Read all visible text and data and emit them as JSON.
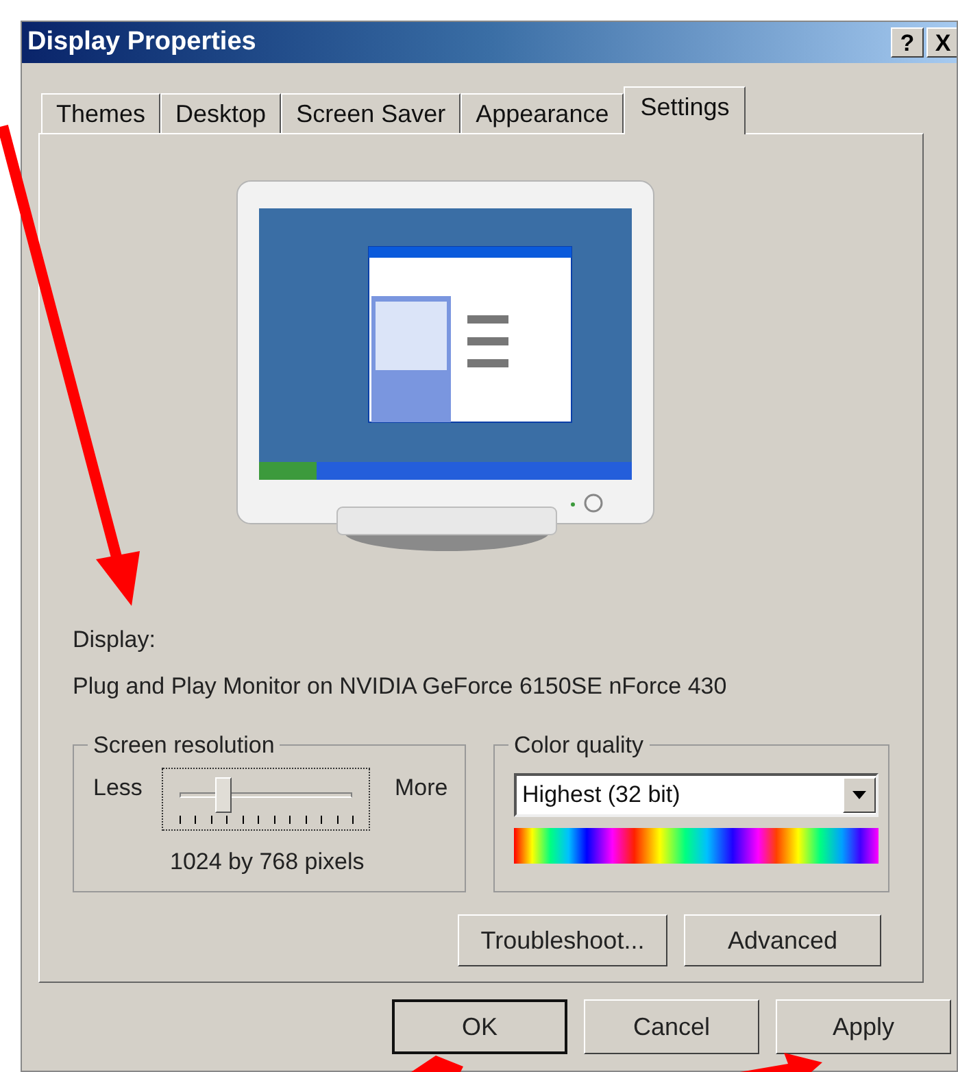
{
  "window": {
    "title": "Display Properties",
    "title_buttons": [
      "?",
      "X"
    ]
  },
  "tabs": [
    {
      "label": "Themes",
      "selected": false
    },
    {
      "label": "Desktop",
      "selected": false
    },
    {
      "label": "Screen Saver",
      "selected": false
    },
    {
      "label": "Appearance",
      "selected": false
    },
    {
      "label": "Settings",
      "selected": true
    }
  ],
  "display": {
    "label": "Display:",
    "device": "Plug and Play Monitor on NVIDIA GeForce 6150SE nForce 430"
  },
  "screen_resolution": {
    "title": "Screen resolution",
    "min_label": "Less",
    "max_label": "More",
    "level": 0.25,
    "reading": "1024 by 768 pixels"
  },
  "color_quality": {
    "title": "Color quality",
    "value": "Highest (32 bit)"
  },
  "panel_buttons": [
    "Troubleshoot...",
    "Advanced"
  ],
  "dialog_buttons": [
    {
      "label": "OK",
      "default": true
    },
    {
      "label": "Cancel",
      "default": false
    },
    {
      "label": "Apply",
      "default": false
    }
  ]
}
